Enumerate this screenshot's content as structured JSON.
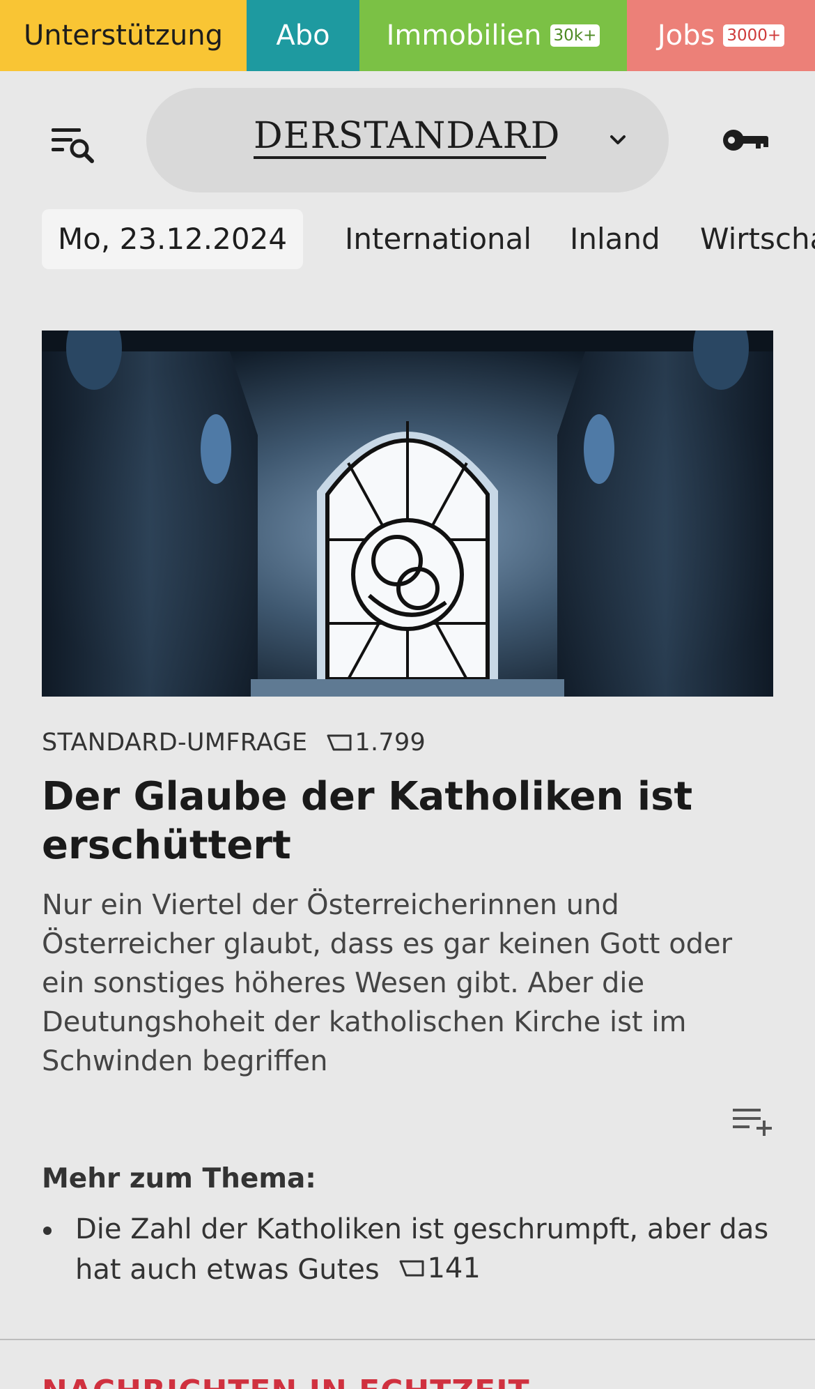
{
  "topbar": {
    "support_label": "Unterstützung",
    "abo_label": "Abo",
    "immobilien_label": "Immobilien",
    "immobilien_badge": "30k+",
    "jobs_label": "Jobs",
    "jobs_badge": "3000+"
  },
  "header": {
    "logo_text": "DERSTANDARD",
    "menu_icon": "menu-search-icon",
    "account_icon": "key-icon",
    "dropdown_icon": "chevron-down-icon"
  },
  "nav": {
    "date": "Mo, 23.12.2024",
    "items": [
      "International",
      "Inland",
      "Wirtschaft"
    ]
  },
  "article": {
    "kicker": "STANDARD-UMFRAGE",
    "comment_count": "1.799",
    "headline": "Der Glaube der Katholiken ist erschüttert",
    "teaser": "Nur ein Viertel der Österreicherinnen und Österreicher glaubt, dass es gar keinen Gott oder ein sonstiges höheres Wesen gibt. Aber die Deutungshoheit der katholischen Kirche ist im Schwinden begriffen",
    "playlist_icon": "playlist-add-icon"
  },
  "related": {
    "title": "Mehr zum Thema:",
    "items": [
      {
        "text": "Die Zahl der Katholiken ist geschrumpft, aber das hat auch etwas Gutes",
        "comments": "141"
      }
    ]
  },
  "next_section": {
    "title": "NACHRICHTEN IN ECHTZEIT"
  },
  "colors": {
    "support": "#f9c534",
    "abo": "#1e9aa0",
    "immobilien": "#7bc145",
    "jobs": "#ec8078",
    "section_red": "#d0313f",
    "background": "#e8e8e8"
  }
}
